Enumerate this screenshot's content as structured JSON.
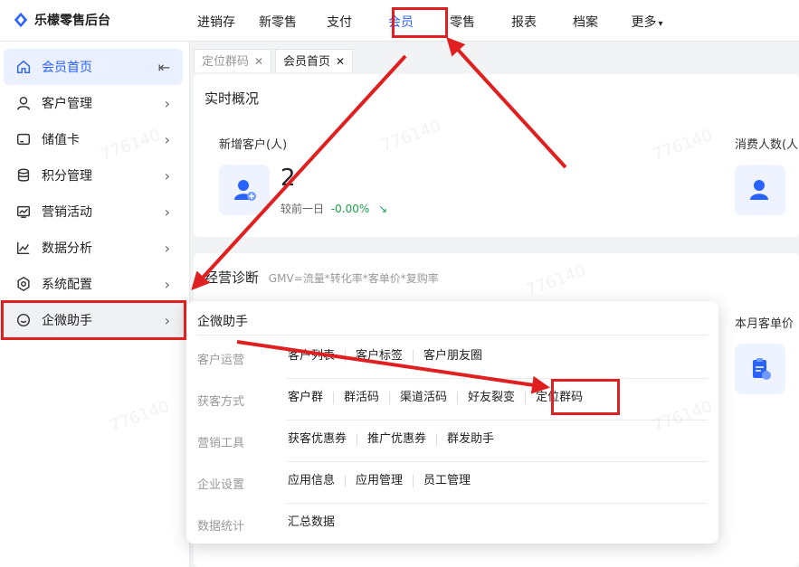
{
  "brand": {
    "name": "乐檬零售后台"
  },
  "topnav": [
    {
      "label": "进销存"
    },
    {
      "label": "新零售"
    },
    {
      "label": "支付"
    },
    {
      "label": "会员"
    },
    {
      "label": "零售"
    },
    {
      "label": "报表"
    },
    {
      "label": "档案"
    },
    {
      "label": "更多"
    }
  ],
  "sidebar": {
    "items": [
      {
        "label": "会员首页"
      },
      {
        "label": "客户管理"
      },
      {
        "label": "储值卡"
      },
      {
        "label": "积分管理"
      },
      {
        "label": "营销活动"
      },
      {
        "label": "数据分析"
      },
      {
        "label": "系统配置"
      },
      {
        "label": "企微助手"
      }
    ],
    "collapse_icon": "collapse-left-icon"
  },
  "tabs": [
    {
      "label": "定位群码",
      "close": "✕"
    },
    {
      "label": "会员首页",
      "close": "✕"
    }
  ],
  "overview": {
    "title": "实时概况",
    "new_customers_label": "新增客户(人)",
    "new_customers_value": "2",
    "compare_label": "较前一日",
    "compare_value": "-0.00%",
    "consumers_label": "消费人数(人"
  },
  "diagnosis": {
    "title": "经营诊断",
    "formula": "GMV=流量*转化率*客单价*复购率",
    "monthly_label": "本月客单价"
  },
  "panel": {
    "title": "企微助手",
    "rows": [
      {
        "label": "客户运营",
        "links": [
          "客户列表",
          "客户标签",
          "客户朋友圈"
        ]
      },
      {
        "label": "获客方式",
        "links": [
          "客户群",
          "群活码",
          "渠道活码",
          "好友裂变",
          "定位群码"
        ]
      },
      {
        "label": "营销工具",
        "links": [
          "获客优惠券",
          "推广优惠券",
          "群发助手"
        ]
      },
      {
        "label": "企业设置",
        "links": [
          "应用信息",
          "应用管理",
          "员工管理"
        ]
      },
      {
        "label": "数据统计",
        "links": [
          "汇总数据"
        ]
      }
    ]
  },
  "watermark": "776140",
  "colors": {
    "accent": "#2a62ff",
    "highlight": "#e02020",
    "positive": "#1a9f4a"
  }
}
